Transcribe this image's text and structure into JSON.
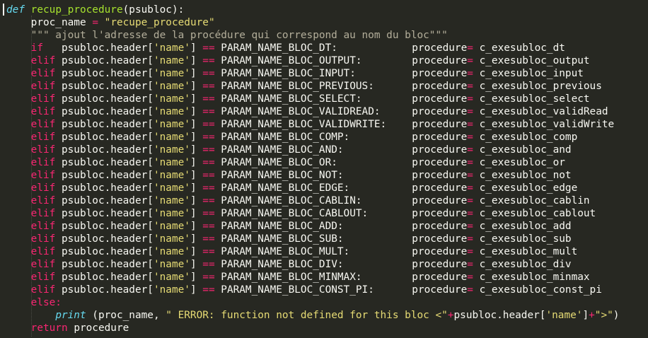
{
  "editor": {
    "theme_colors": {
      "background": "#272822",
      "keyword": "#f92672",
      "string": "#e6db74",
      "function": "#a6e22e",
      "builtin": "#66d9ef",
      "text": "#f8f8f2"
    },
    "def_line": {
      "kw": "def",
      "name": "recup_procedure",
      "params": "(psubloc):"
    },
    "assign_line": {
      "lhs": "proc_name",
      "op": "=",
      "value": "\"recupe_procedure\""
    },
    "docstring": "\"\"\" ajout l'adresse de la procédure qui correspond au nom du bloc\"\"\"",
    "branches": [
      {
        "kw": "if  ",
        "param": "PARAM_NAME_BLOC_DT:",
        "proc": "c_exesubloc_dt"
      },
      {
        "kw": "elif",
        "param": "PARAM_NAME_BLOC_OUTPUT:",
        "proc": "c_exesubloc_output"
      },
      {
        "kw": "elif",
        "param": "PARAM_NAME_BLOC_INPUT:",
        "proc": "c_exesubloc_input"
      },
      {
        "kw": "elif",
        "param": "PARAM_NAME_BLOC_PREVIOUS:",
        "proc": "c_exesubloc_previous"
      },
      {
        "kw": "elif",
        "param": "PARAM_NAME_BLOC_SELECT:",
        "proc": "c_exesubloc_select"
      },
      {
        "kw": "elif",
        "param": "PARAM_NAME_BLOC_VALIDREAD:",
        "proc": "c_exesubloc_validRead"
      },
      {
        "kw": "elif",
        "param": "PARAM_NAME_BLOC_VALIDWRITE:",
        "proc": "c_exesubloc_validWrite"
      },
      {
        "kw": "elif",
        "param": "PARAM_NAME_BLOC_COMP:",
        "proc": "c_exesubloc_comp"
      },
      {
        "kw": "elif",
        "param": "PARAM_NAME_BLOC_AND:",
        "proc": "c_exesubloc_and"
      },
      {
        "kw": "elif",
        "param": "PARAM_NAME_BLOC_OR:",
        "proc": "c_exesubloc_or"
      },
      {
        "kw": "elif",
        "param": "PARAM_NAME_BLOC_NOT:",
        "proc": "c_exesubloc_not"
      },
      {
        "kw": "elif",
        "param": "PARAM_NAME_BLOC_EDGE:",
        "proc": "c_exesubloc_edge"
      },
      {
        "kw": "elif",
        "param": "PARAM_NAME_BLOC_CABLIN:",
        "proc": "c_exesubloc_cablin"
      },
      {
        "kw": "elif",
        "param": "PARAM_NAME_BLOC_CABLOUT:",
        "proc": "c_exesubloc_cablout"
      },
      {
        "kw": "elif",
        "param": "PARAM_NAME_BLOC_ADD:",
        "proc": "c_exesubloc_add"
      },
      {
        "kw": "elif",
        "param": "PARAM_NAME_BLOC_SUB:",
        "proc": "c_exesubloc_sub"
      },
      {
        "kw": "elif",
        "param": "PARAM_NAME_BLOC_MULT:",
        "proc": "c_exesubloc_mult"
      },
      {
        "kw": "elif",
        "param": "PARAM_NAME_BLOC_DIV:",
        "proc": "c_exesubloc_div"
      },
      {
        "kw": "elif",
        "param": "PARAM_NAME_BLOC_MINMAX:",
        "proc": "c_exesubloc_minmax"
      },
      {
        "kw": "elif",
        "param": "PARAM_NAME_BLOC_CONST_PI:",
        "proc": "c_exesubloc_const_pi"
      }
    ],
    "branch_subject": "psubloc.header[",
    "branch_key": "'name'",
    "branch_close": "]",
    "branch_eq": "==",
    "branch_target": "procedure",
    "branch_assign": "=",
    "else_line": "else:",
    "print_line": {
      "fn": "print",
      "open": " (proc_name, ",
      "msg": "\" ERROR: function not defined for this bloc <\"",
      "plus1": "+",
      "subject": "psubloc.header[",
      "key": "'name'",
      "close": "]",
      "plus2": "+",
      "tail_str": "\">\"",
      "end": ")"
    },
    "return_line": {
      "kw": "return",
      "value": "procedure"
    }
  }
}
